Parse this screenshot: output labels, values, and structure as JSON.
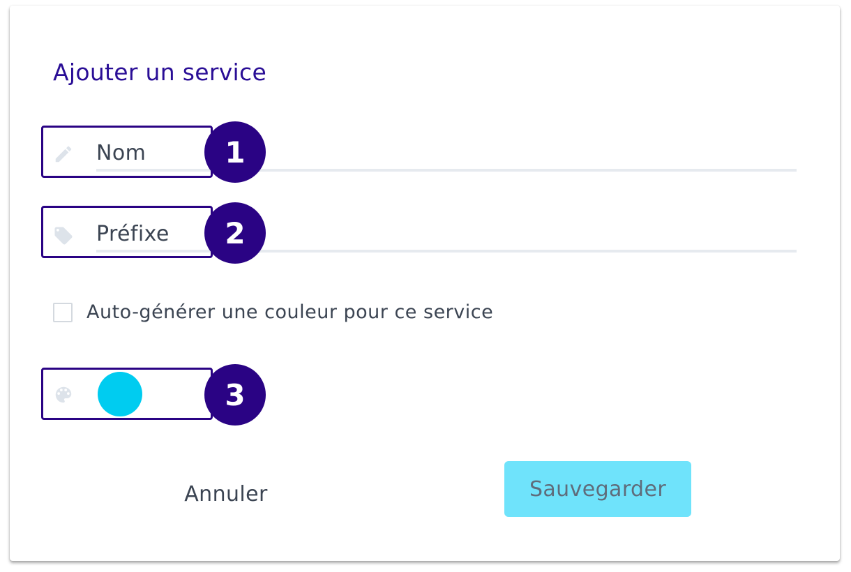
{
  "dialog": {
    "title": "Ajouter un service"
  },
  "fields": {
    "name": {
      "value": "Nom",
      "icon": "pencil-icon",
      "step": "1"
    },
    "prefix": {
      "value": "Préfixe",
      "icon": "tag-icon",
      "step": "2"
    },
    "color": {
      "icon": "palette-icon",
      "step": "3",
      "swatch_color": "#00ccf0"
    }
  },
  "auto_color": {
    "label": "Auto-générer une couleur pour ce service",
    "checked": false
  },
  "actions": {
    "cancel_label": "Annuler",
    "save_label": "Sauvegarder"
  },
  "colors": {
    "title": "#2a0e96",
    "highlight": "#2a0384",
    "save_button_bg": "#6fe3fb",
    "icon": "#dde3ea"
  }
}
